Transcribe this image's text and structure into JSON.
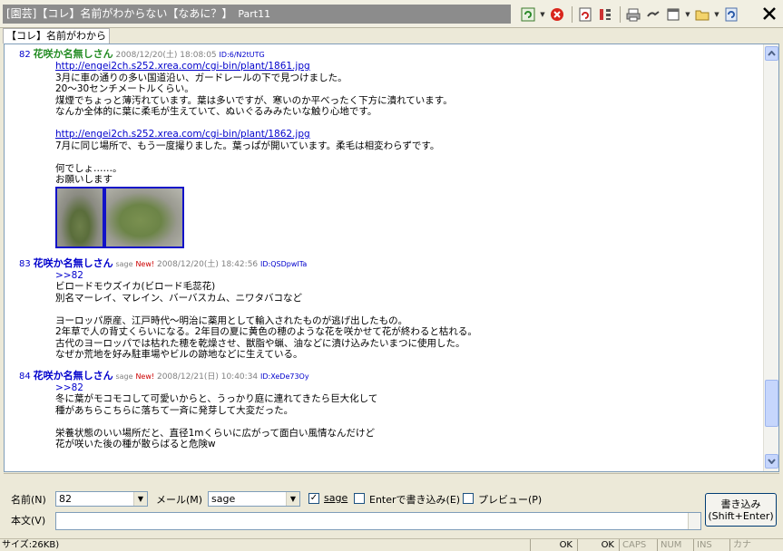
{
  "window": {
    "title": "[園芸]【コレ】名前がわからない【なあに？】",
    "part": "Part11",
    "subtitle_tab": "【コレ】名前がわから"
  },
  "toolbar": {
    "icons": [
      "reload-icon",
      "stop-icon",
      "refresh-icon",
      "column-icon",
      "print-icon",
      "link-icon",
      "window-icon",
      "folder-icon",
      "options-icon"
    ]
  },
  "posts": [
    {
      "number": "82",
      "name": "花咲か名無しさん",
      "mail": "",
      "new": "",
      "date": "2008/12/20(土) 18:08:05",
      "id": "ID:6/N2tUTG",
      "lines": [
        {
          "type": "link",
          "text": "http://engei2ch.s252.xrea.com/cgi-bin/plant/1861.jpg"
        },
        {
          "type": "text",
          "text": "3月に車の通りの多い国道沿い、ガードレールの下で見つけました。"
        },
        {
          "type": "text",
          "text": "20〜30センチメートルくらい。"
        },
        {
          "type": "text",
          "text": "煤煙でちょっと薄汚れています。葉は多いですが、寒いのか平べったく下方に潰れています。"
        },
        {
          "type": "text",
          "text": "なんか全体的に葉に柔毛が生えていて、ぬいぐるみみたいな触り心地です。"
        },
        {
          "type": "blank",
          "text": ""
        },
        {
          "type": "link",
          "text": "http://engei2ch.s252.xrea.com/cgi-bin/plant/1862.jpg"
        },
        {
          "type": "text",
          "text": "7月に同じ場所で、もう一度撮りました。葉っぱが開いています。柔毛は相変わらずです。"
        },
        {
          "type": "blank",
          "text": ""
        },
        {
          "type": "text",
          "text": "何でしょ……。"
        },
        {
          "type": "text",
          "text": "お願いします"
        }
      ]
    },
    {
      "number": "83",
      "name": "花咲か名無しさん",
      "mail": "sage",
      "new": "New!",
      "date": "2008/12/20(土) 18:42:56",
      "id": "ID:QSDpwITa",
      "lines": [
        {
          "type": "anchor",
          "text": ">>82"
        },
        {
          "type": "text",
          "text": "ビロードモウズイカ(ビロード毛蕊花)"
        },
        {
          "type": "text",
          "text": "別名マーレイ、マレイン、バーバスカム、ニワタバコなど"
        },
        {
          "type": "blank",
          "text": ""
        },
        {
          "type": "text",
          "text": "ヨーロッパ原産、江戸時代〜明治に薬用として輸入されたものが逃げ出したもの。"
        },
        {
          "type": "text",
          "text": "2年草で人の背丈くらいになる。2年目の夏に黄色の穂のような花を咲かせて花が終わると枯れる。"
        },
        {
          "type": "text",
          "text": "古代のヨーロッパでは枯れた穂を乾燥させ、獣脂や蝋、油などに漬け込みたいまつに使用した。"
        },
        {
          "type": "text",
          "text": "なぜか荒地を好み駐車場やビルの跡地などに生えている。"
        }
      ]
    },
    {
      "number": "84",
      "name": "花咲か名無しさん",
      "mail": "sage",
      "new": "New!",
      "date": "2008/12/21(日) 10:40:34",
      "id": "ID:XeDe73Oy",
      "lines": [
        {
          "type": "anchor",
          "text": ">>82"
        },
        {
          "type": "text",
          "text": "冬に葉がモコモコして可愛いからと、うっかり庭に連れてきたら巨大化して"
        },
        {
          "type": "text",
          "text": "種があちらこちらに落ちて一斉に発芽して大変だった。"
        },
        {
          "type": "blank",
          "text": ""
        },
        {
          "type": "text",
          "text": "栄養状態のいい場所だと、直径1mくらいに広がって面白い風情なんだけど"
        },
        {
          "type": "text",
          "text": "花が咲いた後の種が散らばると危険w"
        }
      ]
    }
  ],
  "form": {
    "name_label": "名前(N)",
    "name_value": "82",
    "mail_label": "メール(M)",
    "mail_value": "sage",
    "sage_label": "sage",
    "sage_checked": true,
    "enter_label": "Enterで書き込み(E)",
    "preview_label": "プレビュー(P)",
    "body_label": "本文(V)",
    "submit_label": "書き込み",
    "submit_sub": "(Shift+Enter)"
  },
  "status": {
    "size": "サイズ:26KB)",
    "ok1": "OK",
    "ok2": "OK",
    "caps": "CAPS",
    "num": "NUM",
    "ins": "INS",
    "kana": "カナ"
  },
  "colors": {
    "link": "#0000cc",
    "name_green": "#228b22",
    "new": "#cc0000",
    "title_bg": "#8c8c8c"
  }
}
